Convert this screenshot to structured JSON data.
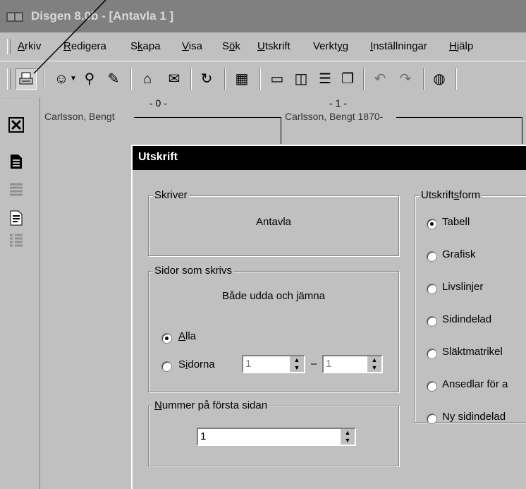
{
  "window": {
    "title": "Disgen 8.0b - [Antavla 1 ]"
  },
  "menu": [
    {
      "pre": "",
      "key": "A",
      "post": "rkiv"
    },
    {
      "pre": "",
      "key": "R",
      "post": "edigera"
    },
    {
      "pre": "S",
      "key": "k",
      "post": "apa"
    },
    {
      "pre": "",
      "key": "V",
      "post": "isa"
    },
    {
      "pre": "S",
      "key": "ö",
      "post": "k"
    },
    {
      "pre": "",
      "key": "U",
      "post": "tskrift"
    },
    {
      "pre": "Verkt",
      "key": "y",
      "post": "g"
    },
    {
      "pre": "",
      "key": "I",
      "post": "nställningar"
    },
    {
      "pre": "",
      "key": "H",
      "post": "jälp"
    }
  ],
  "toolbar": {
    "icons": [
      "print-icon",
      "face-icon",
      "binoculars-icon",
      "edit-icon",
      "home-icon",
      "book-icon",
      "link-icon",
      "calendar-icon",
      "window-single-icon",
      "window-columns-icon",
      "window-rows-icon",
      "window-cascade-icon",
      "undo-icon",
      "redo-icon",
      "globe-icon"
    ]
  },
  "chart": {
    "gen0": "- 0 -",
    "gen1": "- 1 -",
    "person0": "Carlsson, Bengt",
    "person1": "Carlsson, Bengt 1870-"
  },
  "dialog": {
    "title": "Utskrift",
    "printer_group": "Skriver",
    "printer_value": "Antavla",
    "pages_group": "Sidor som skrivs",
    "pages_desc": "Både udda och jämna",
    "radio_all": {
      "key": "A",
      "post": "lla",
      "selected": true
    },
    "radio_pages": {
      "pre": "S",
      "key": "i",
      "post": "dorna",
      "selected": false
    },
    "pages_from": "1",
    "pages_dash": "–",
    "pages_to": "1",
    "first_page_group": {
      "key": "N",
      "post": "ummer på första sidan"
    },
    "first_page_value": "1",
    "form_group": {
      "pre": "Utskrift",
      "key": "s",
      "post": "form"
    },
    "forms": [
      {
        "label": "Tabell",
        "selected": true
      },
      {
        "label": "Grafisk",
        "selected": false
      },
      {
        "label": "Livslinjer",
        "selected": false
      },
      {
        "label": "Sidindelad",
        "selected": false
      },
      {
        "label": "Släktmatrikel",
        "selected": false
      },
      {
        "label": "Ansedlar för a",
        "selected": false
      },
      {
        "label": "Ny sidindelad",
        "selected": false
      }
    ]
  }
}
